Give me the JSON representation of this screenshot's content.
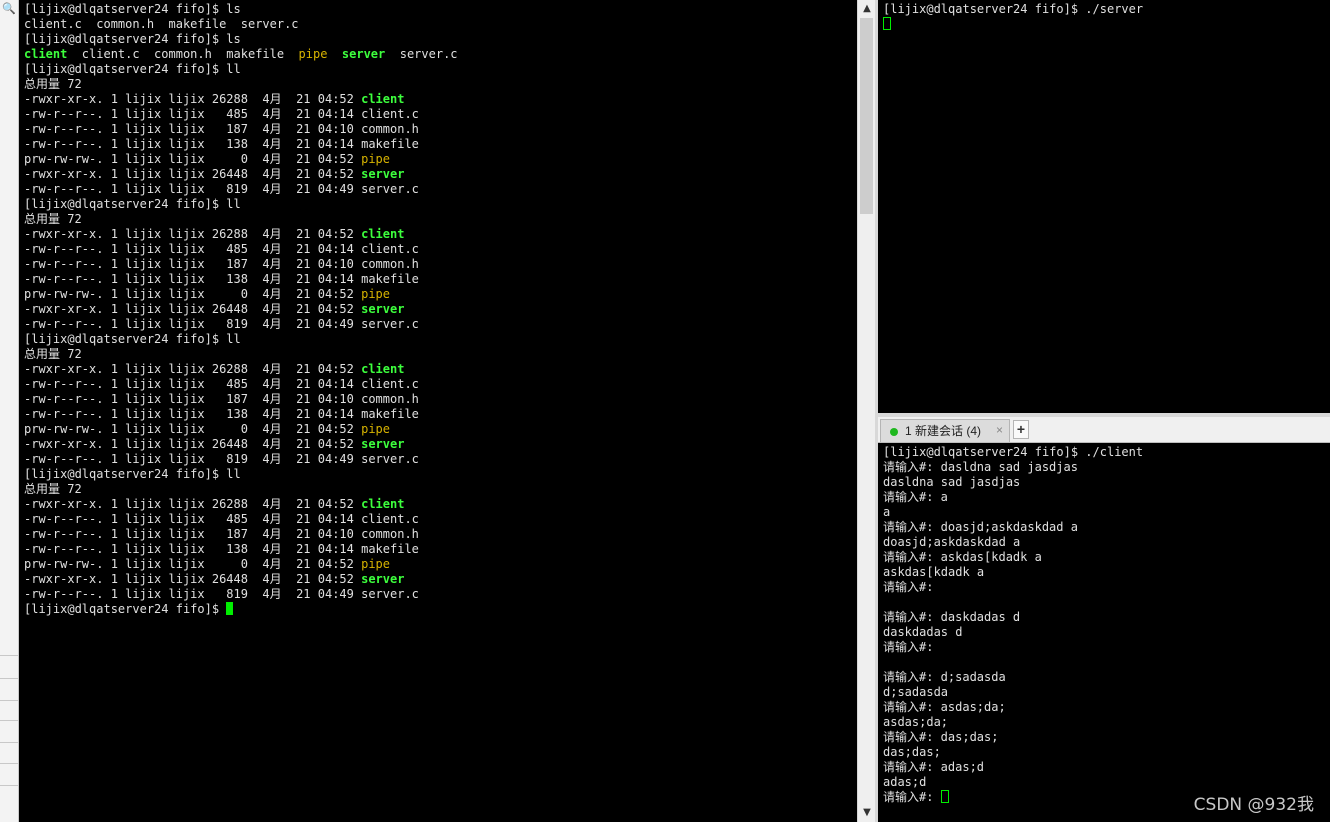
{
  "colors": {
    "terminal_bg": "#000000",
    "text": "#e0e0e0",
    "executable": "#3dff3d",
    "fifo": "#d7b300",
    "cursor": "#00ee00"
  },
  "left_terminal": {
    "lines": [
      [
        {
          "t": "[lijix@dlqatserver24 fifo]$ ls"
        }
      ],
      [
        {
          "t": "client.c  common.h  makefile  server.c"
        }
      ],
      [
        {
          "t": "[lijix@dlqatserver24 fifo]$ ls"
        }
      ],
      [
        {
          "t": "client",
          "c": "exe"
        },
        {
          "t": "  client.c  common.h  makefile  "
        },
        {
          "t": "pipe",
          "c": "fifo"
        },
        {
          "t": "  "
        },
        {
          "t": "server",
          "c": "exe"
        },
        {
          "t": "  server.c"
        }
      ],
      [
        {
          "t": "[lijix@dlqatserver24 fifo]$ ll"
        }
      ],
      [
        {
          "t": "总用量 72"
        }
      ],
      [
        {
          "t": "-rwxr-xr-x. 1 lijix lijix 26288  4月  21 04:52 "
        },
        {
          "t": "client",
          "c": "exe"
        }
      ],
      [
        {
          "t": "-rw-r--r--. 1 lijix lijix   485  4月  21 04:14 client.c"
        }
      ],
      [
        {
          "t": "-rw-r--r--. 1 lijix lijix   187  4月  21 04:10 common.h"
        }
      ],
      [
        {
          "t": "-rw-r--r--. 1 lijix lijix   138  4月  21 04:14 makefile"
        }
      ],
      [
        {
          "t": "prw-rw-rw-. 1 lijix lijix     0  4月  21 04:52 "
        },
        {
          "t": "pipe",
          "c": "fifo"
        }
      ],
      [
        {
          "t": "-rwxr-xr-x. 1 lijix lijix 26448  4月  21 04:52 "
        },
        {
          "t": "server",
          "c": "exe"
        }
      ],
      [
        {
          "t": "-rw-r--r--. 1 lijix lijix   819  4月  21 04:49 server.c"
        }
      ],
      [
        {
          "t": "[lijix@dlqatserver24 fifo]$ ll"
        }
      ],
      [
        {
          "t": "总用量 72"
        }
      ],
      [
        {
          "t": "-rwxr-xr-x. 1 lijix lijix 26288  4月  21 04:52 "
        },
        {
          "t": "client",
          "c": "exe"
        }
      ],
      [
        {
          "t": "-rw-r--r--. 1 lijix lijix   485  4月  21 04:14 client.c"
        }
      ],
      [
        {
          "t": "-rw-r--r--. 1 lijix lijix   187  4月  21 04:10 common.h"
        }
      ],
      [
        {
          "t": "-rw-r--r--. 1 lijix lijix   138  4月  21 04:14 makefile"
        }
      ],
      [
        {
          "t": "prw-rw-rw-. 1 lijix lijix     0  4月  21 04:52 "
        },
        {
          "t": "pipe",
          "c": "fifo"
        }
      ],
      [
        {
          "t": "-rwxr-xr-x. 1 lijix lijix 26448  4月  21 04:52 "
        },
        {
          "t": "server",
          "c": "exe"
        }
      ],
      [
        {
          "t": "-rw-r--r--. 1 lijix lijix   819  4月  21 04:49 server.c"
        }
      ],
      [
        {
          "t": "[lijix@dlqatserver24 fifo]$ ll"
        }
      ],
      [
        {
          "t": "总用量 72"
        }
      ],
      [
        {
          "t": "-rwxr-xr-x. 1 lijix lijix 26288  4月  21 04:52 "
        },
        {
          "t": "client",
          "c": "exe"
        }
      ],
      [
        {
          "t": "-rw-r--r--. 1 lijix lijix   485  4月  21 04:14 client.c"
        }
      ],
      [
        {
          "t": "-rw-r--r--. 1 lijix lijix   187  4月  21 04:10 common.h"
        }
      ],
      [
        {
          "t": "-rw-r--r--. 1 lijix lijix   138  4月  21 04:14 makefile"
        }
      ],
      [
        {
          "t": "prw-rw-rw-. 1 lijix lijix     0  4月  21 04:52 "
        },
        {
          "t": "pipe",
          "c": "fifo"
        }
      ],
      [
        {
          "t": "-rwxr-xr-x. 1 lijix lijix 26448  4月  21 04:52 "
        },
        {
          "t": "server",
          "c": "exe"
        }
      ],
      [
        {
          "t": "-rw-r--r--. 1 lijix lijix   819  4月  21 04:49 server.c"
        }
      ],
      [
        {
          "t": "[lijix@dlqatserver24 fifo]$ ll"
        }
      ],
      [
        {
          "t": "总用量 72"
        }
      ],
      [
        {
          "t": "-rwxr-xr-x. 1 lijix lijix 26288  4月  21 04:52 "
        },
        {
          "t": "client",
          "c": "exe"
        }
      ],
      [
        {
          "t": "-rw-r--r--. 1 lijix lijix   485  4月  21 04:14 client.c"
        }
      ],
      [
        {
          "t": "-rw-r--r--. 1 lijix lijix   187  4月  21 04:10 common.h"
        }
      ],
      [
        {
          "t": "-rw-r--r--. 1 lijix lijix   138  4月  21 04:14 makefile"
        }
      ],
      [
        {
          "t": "prw-rw-rw-. 1 lijix lijix     0  4月  21 04:52 "
        },
        {
          "t": "pipe",
          "c": "fifo"
        }
      ],
      [
        {
          "t": "-rwxr-xr-x. 1 lijix lijix 26448  4月  21 04:52 "
        },
        {
          "t": "server",
          "c": "exe"
        }
      ],
      [
        {
          "t": "-rw-r--r--. 1 lijix lijix   819  4月  21 04:49 server.c"
        }
      ],
      [
        {
          "t": "[lijix@dlqatserver24 fifo]$ "
        },
        {
          "cursor": "block"
        }
      ]
    ]
  },
  "right_top_terminal": {
    "lines": [
      [
        {
          "t": "[lijix@dlqatserver24 fifo]$ ./server"
        }
      ],
      [
        {
          "cursor": "hollow"
        }
      ]
    ]
  },
  "session_tab": {
    "label": "1 新建会话 (4)",
    "close": "×",
    "add": "+",
    "status": "connected"
  },
  "right_bottom_terminal": {
    "lines": [
      [
        {
          "t": "[lijix@dlqatserver24 fifo]$ ./client"
        }
      ],
      [
        {
          "t": "请输入#: dasldna sad jasdjas"
        }
      ],
      [
        {
          "t": "dasldna sad jasdjas"
        }
      ],
      [
        {
          "t": "请输入#: a"
        }
      ],
      [
        {
          "t": "a"
        }
      ],
      [
        {
          "t": "请输入#: doasjd;askdaskdad a"
        }
      ],
      [
        {
          "t": "doasjd;askdaskdad a"
        }
      ],
      [
        {
          "t": "请输入#: askdas[kdadk a"
        }
      ],
      [
        {
          "t": "askdas[kdadk a"
        }
      ],
      [
        {
          "t": "请输入#:"
        }
      ],
      [
        {
          "t": ""
        }
      ],
      [
        {
          "t": "请输入#: daskdadas d"
        }
      ],
      [
        {
          "t": "daskdadas d"
        }
      ],
      [
        {
          "t": "请输入#:"
        }
      ],
      [
        {
          "t": ""
        }
      ],
      [
        {
          "t": "请输入#: d;sadasda"
        }
      ],
      [
        {
          "t": "d;sadasda"
        }
      ],
      [
        {
          "t": "请输入#: asdas;da;"
        }
      ],
      [
        {
          "t": "asdas;da;"
        }
      ],
      [
        {
          "t": "请输入#: das;das;"
        }
      ],
      [
        {
          "t": "das;das;"
        }
      ],
      [
        {
          "t": "请输入#: adas;d"
        }
      ],
      [
        {
          "t": "adas;d"
        }
      ],
      [
        {
          "t": "请输入#: "
        },
        {
          "cursor": "hollow"
        }
      ]
    ]
  },
  "watermark": "CSDN @932我"
}
